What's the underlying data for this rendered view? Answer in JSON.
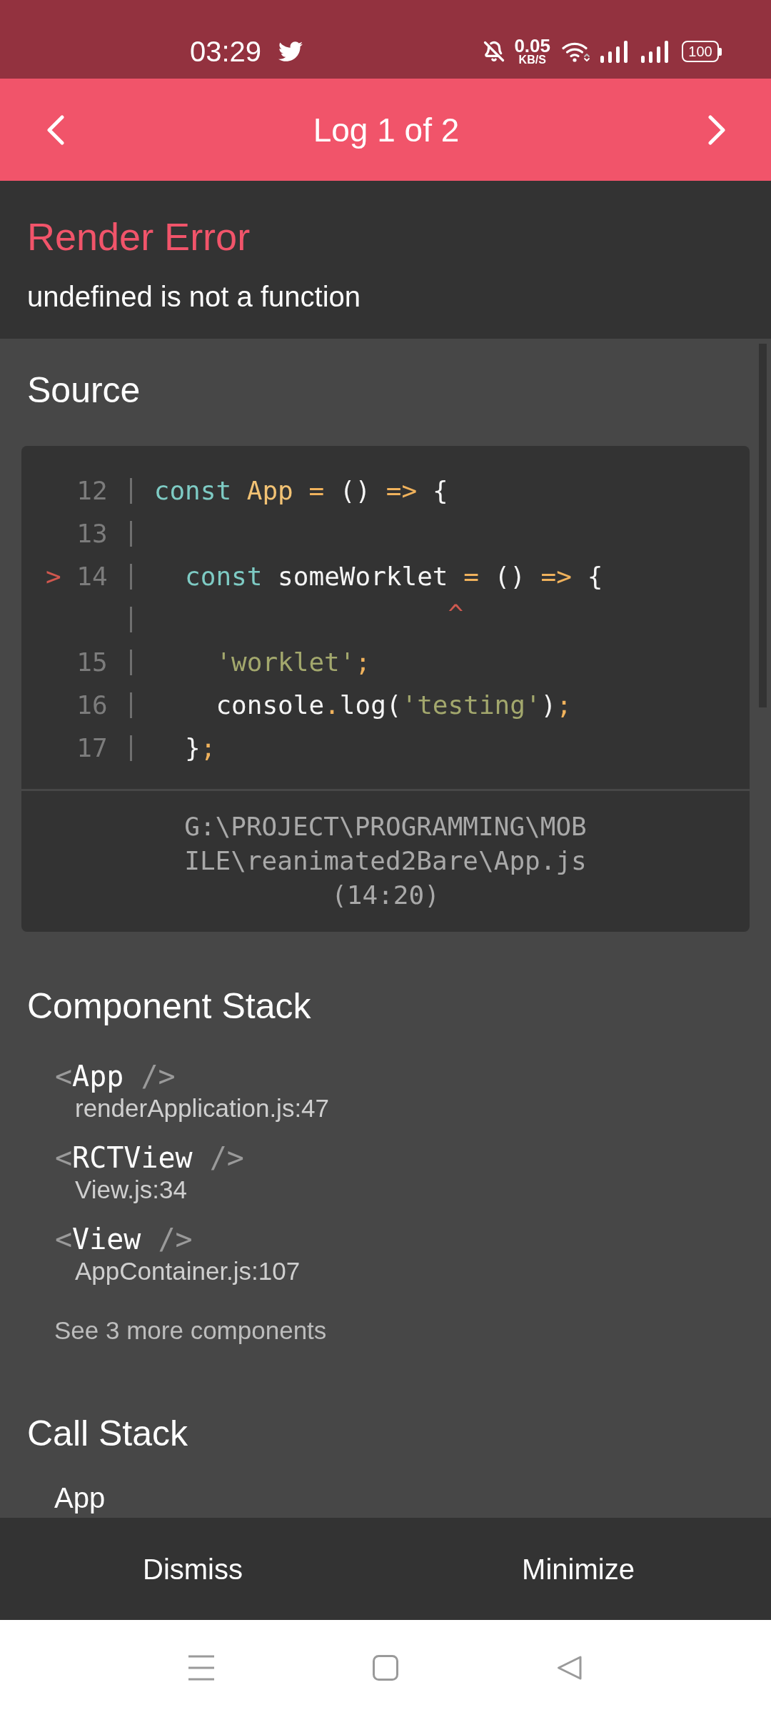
{
  "status_bar": {
    "time": "03:29",
    "network_speed": "0.05",
    "network_unit": "KB/S",
    "battery": "100"
  },
  "header": {
    "title": "Log 1 of 2"
  },
  "error": {
    "title": "Render Error",
    "message": "undefined is not a function"
  },
  "source": {
    "heading": "Source",
    "code_frame": {
      "lines": [
        {
          "kind": "code",
          "number": "12",
          "tokens": [
            {
              "kind": "keyword",
              "text": "const"
            },
            {
              "kind": "name",
              "text": " App"
            },
            {
              "kind": "punct",
              "text": " ="
            },
            {
              "kind": "plain",
              "text": " () "
            },
            {
              "kind": "punct",
              "text": "=>"
            },
            {
              "kind": "plain",
              "text": " {"
            }
          ]
        },
        {
          "kind": "code",
          "number": "13"
        },
        {
          "kind": "code",
          "marker": ">",
          "number": "14",
          "tokens": [
            {
              "kind": "keyword",
              "text": "  const"
            },
            {
              "kind": "plain",
              "text": " someWorklet "
            },
            {
              "kind": "punct",
              "text": "="
            },
            {
              "kind": "plain",
              "text": " () "
            },
            {
              "kind": "punct",
              "text": "=>"
            },
            {
              "kind": "plain",
              "text": " {"
            }
          ]
        },
        {
          "kind": "caret",
          "text": "                   ^"
        },
        {
          "kind": "code",
          "number": "15",
          "tokens": [
            {
              "kind": "string",
              "text": "    'worklet'"
            },
            {
              "kind": "punct",
              "text": ";"
            }
          ]
        },
        {
          "kind": "code",
          "number": "16",
          "tokens": [
            {
              "kind": "plain",
              "text": "    console"
            },
            {
              "kind": "punct",
              "text": "."
            },
            {
              "kind": "plain",
              "text": "log("
            },
            {
              "kind": "string",
              "text": "'testing'"
            },
            {
              "kind": "plain",
              "text": ")"
            },
            {
              "kind": "punct",
              "text": ";"
            }
          ]
        },
        {
          "kind": "code",
          "number": "17",
          "tokens": [
            {
              "kind": "plain",
              "text": "  }"
            },
            {
              "kind": "punct",
              "text": ";"
            }
          ]
        }
      ],
      "file": "G:\\PROJECT\\PROGRAMMING\\MOBILE\\reanimated2Bare\\App.js (14:20)"
    }
  },
  "component_stack": {
    "heading": "Component Stack",
    "items": [
      {
        "open": "<",
        "name": "App",
        "close": "/>",
        "location": "renderApplication.js:47"
      },
      {
        "open": "<",
        "name": "RCTView",
        "close": "/>",
        "location": "View.js:34"
      },
      {
        "open": "<",
        "name": "View",
        "close": "/>",
        "location": "AppContainer.js:107"
      }
    ],
    "more": "See 3 more components"
  },
  "call_stack": {
    "heading": "Call Stack",
    "frames": [
      {
        "name": "App"
      }
    ]
  },
  "footer": {
    "buttons": [
      {
        "label": "Dismiss"
      },
      {
        "label": "Minimize"
      }
    ]
  }
}
